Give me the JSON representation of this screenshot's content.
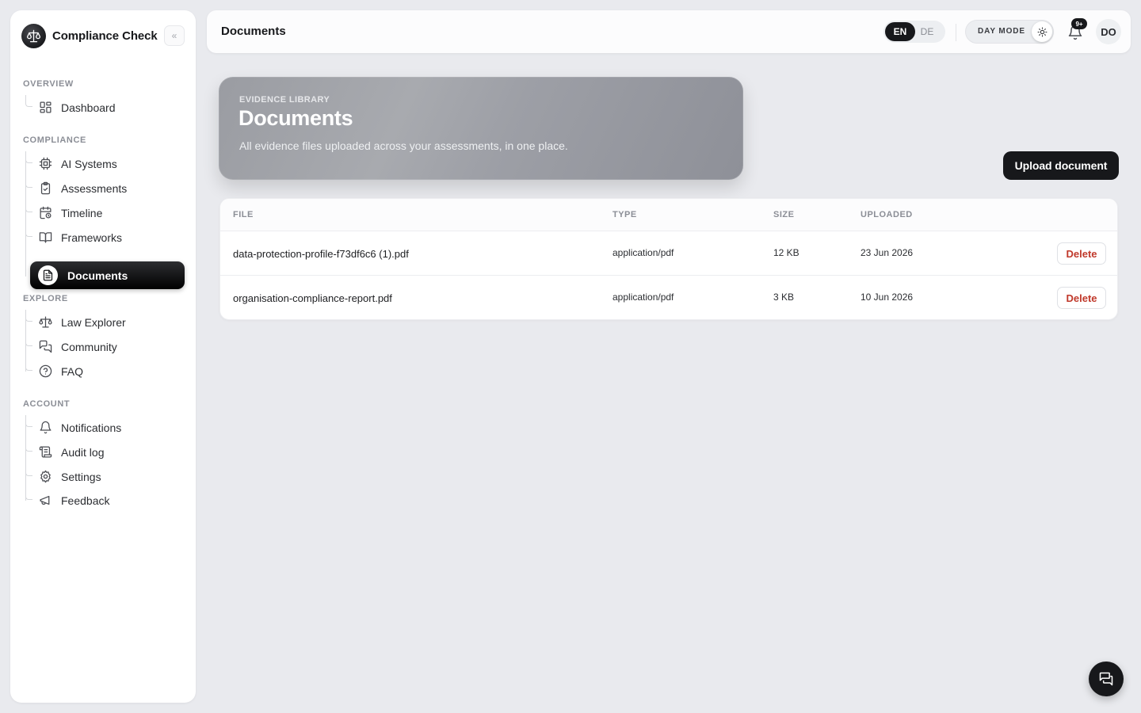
{
  "app": {
    "name": "Compliance Check",
    "collapse_glyph": "«"
  },
  "sidebar": {
    "sections": [
      {
        "label": "OVERVIEW",
        "items": [
          {
            "label": "Dashboard",
            "icon": "dashboard-icon"
          }
        ]
      },
      {
        "label": "COMPLIANCE",
        "items": [
          {
            "label": "AI Systems",
            "icon": "cpu-icon"
          },
          {
            "label": "Assessments",
            "icon": "clipboard-check-icon"
          },
          {
            "label": "Timeline",
            "icon": "calendar-clock-icon"
          },
          {
            "label": "Frameworks",
            "icon": "book-open-icon"
          },
          {
            "label": "Documents",
            "icon": "document-icon",
            "active": true
          }
        ]
      },
      {
        "label": "EXPLORE",
        "items": [
          {
            "label": "Law Explorer",
            "icon": "scale-icon"
          },
          {
            "label": "Community",
            "icon": "chat-bubbles-icon"
          },
          {
            "label": "FAQ",
            "icon": "help-circle-icon"
          }
        ]
      },
      {
        "label": "ACCOUNT",
        "items": [
          {
            "label": "Notifications",
            "icon": "bell-icon"
          },
          {
            "label": "Audit log",
            "icon": "scroll-icon"
          },
          {
            "label": "Settings",
            "icon": "gear-icon"
          },
          {
            "label": "Feedback",
            "icon": "megaphone-icon"
          }
        ]
      }
    ]
  },
  "topbar": {
    "title": "Documents",
    "lang": {
      "en": "EN",
      "de": "DE",
      "selected": "EN"
    },
    "mode_label": "DAY MODE",
    "notifications_badge": "9+",
    "avatar_initials": "DO"
  },
  "hero": {
    "eyebrow": "EVIDENCE LIBRARY",
    "title": "Documents",
    "subtitle": "All evidence files uploaded across your assessments, in one place."
  },
  "actions": {
    "upload_label": "Upload document"
  },
  "table": {
    "columns": [
      "FILE",
      "TYPE",
      "SIZE",
      "UPLOADED"
    ],
    "rows": [
      {
        "file": "data-protection-profile-f73df6c6 (1).pdf",
        "type": "application/pdf",
        "size": "12 KB",
        "uploaded": "23 Jun 2026",
        "action": "Delete"
      },
      {
        "file": "organisation-compliance-report.pdf",
        "type": "application/pdf",
        "size": "3 KB",
        "uploaded": "10 Jun 2026",
        "action": "Delete"
      }
    ]
  },
  "colors": {
    "background": "#e9eaee",
    "primary_dark": "#17181b",
    "danger": "#c0392b",
    "muted": "#8b8e96"
  }
}
